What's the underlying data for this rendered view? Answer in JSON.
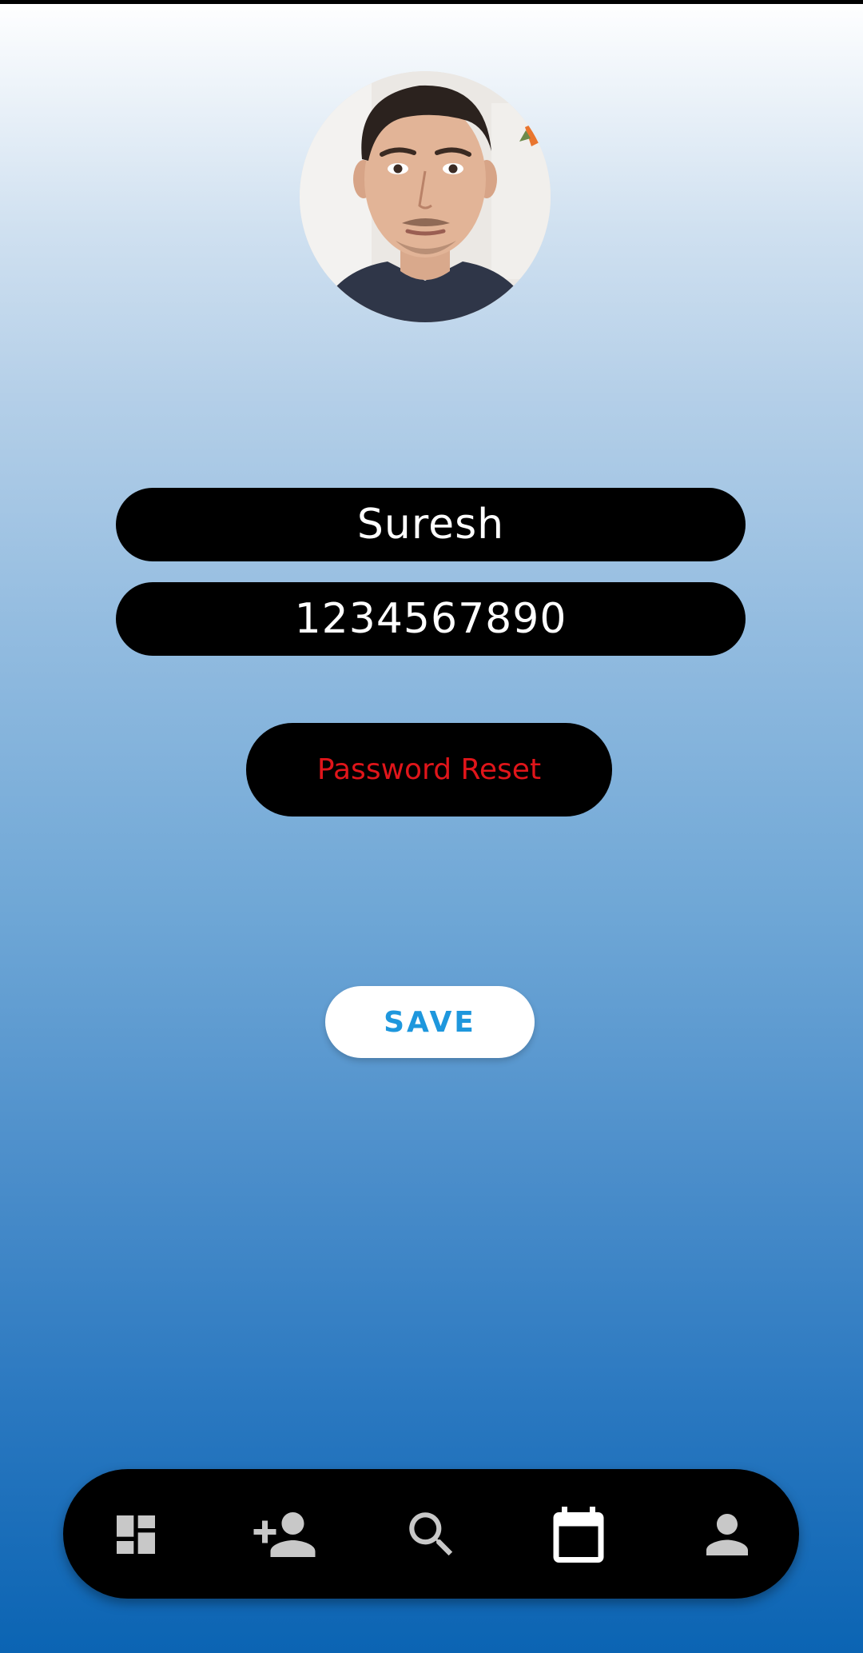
{
  "profile": {
    "name": "Suresh",
    "phone": "1234567890"
  },
  "actions": {
    "password_reset_label": "Password Reset",
    "save_label": "SAVE"
  },
  "bottom_nav": {
    "items": [
      {
        "icon": "dashboard-icon"
      },
      {
        "icon": "add-person-icon"
      },
      {
        "icon": "search-icon"
      },
      {
        "icon": "calendar-icon"
      },
      {
        "icon": "person-icon"
      }
    ]
  },
  "colors": {
    "reset_text": "#e0151a",
    "save_text": "#1e97dd",
    "icon_gray": "#c8c8c8"
  }
}
